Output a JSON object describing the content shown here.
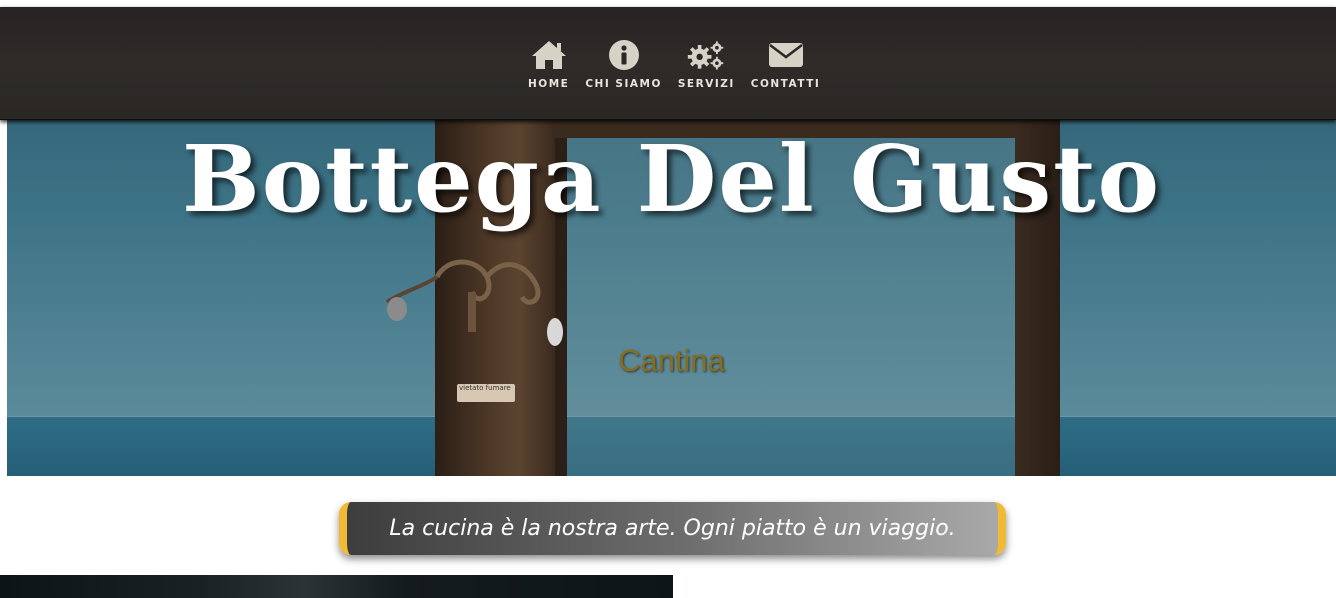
{
  "nav": {
    "items": [
      {
        "label": "HOME",
        "icon": "home-icon"
      },
      {
        "label": "CHI SIAMO",
        "icon": "info-icon"
      },
      {
        "label": "SERVIZI",
        "icon": "gears-icon"
      },
      {
        "label": "CONTATTI",
        "icon": "envelope-icon"
      }
    ]
  },
  "hero": {
    "title": "Bottega Del Gusto",
    "subtitle": "Cantina",
    "sign_text": "vietato fumare"
  },
  "tagline": {
    "text": "La cucina è la nostra arte. Ogni piatto è un viaggio."
  },
  "colors": {
    "nav_background": "#2b2826",
    "icon_color": "#d6d2c6",
    "accent": "#f2b934",
    "subtitle_color": "#8a6d1c"
  }
}
